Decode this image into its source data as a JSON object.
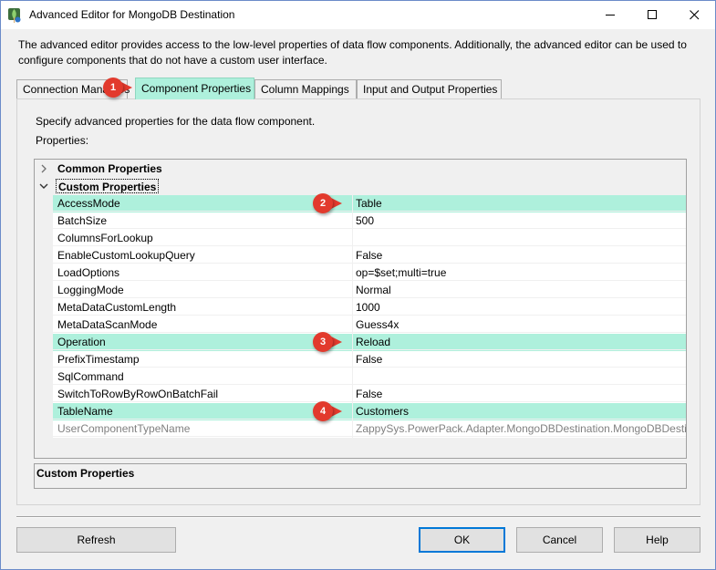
{
  "window": {
    "title": "Advanced Editor for MongoDB Destination"
  },
  "description": "The advanced editor provides access to the low-level properties of data flow components. Additionally, the advanced editor can be used to configure components that do not have a custom user interface.",
  "tabs": [
    {
      "label": "Connection Managers"
    },
    {
      "label": "Component Properties"
    },
    {
      "label": "Column Mappings"
    },
    {
      "label": "Input and Output Properties"
    }
  ],
  "panel": {
    "description": "Specify advanced properties for the data flow component.",
    "properties_label": "Properties:"
  },
  "grid": {
    "categories": {
      "common": "Common Properties",
      "custom": "Custom Properties"
    },
    "rows": [
      {
        "name": "AccessMode",
        "value": "Table"
      },
      {
        "name": "BatchSize",
        "value": "500"
      },
      {
        "name": "ColumnsForLookup",
        "value": ""
      },
      {
        "name": "EnableCustomLookupQuery",
        "value": "False"
      },
      {
        "name": "LoadOptions",
        "value": "op=$set;multi=true"
      },
      {
        "name": "LoggingMode",
        "value": "Normal"
      },
      {
        "name": "MetaDataCustomLength",
        "value": "1000"
      },
      {
        "name": "MetaDataScanMode",
        "value": "Guess4x"
      },
      {
        "name": "Operation",
        "value": "Reload"
      },
      {
        "name": "PrefixTimestamp",
        "value": "False"
      },
      {
        "name": "SqlCommand",
        "value": ""
      },
      {
        "name": "SwitchToRowByRowOnBatchFail",
        "value": "False"
      },
      {
        "name": "TableName",
        "value": "Customers"
      },
      {
        "name": "UserComponentTypeName",
        "value": "ZappySys.PowerPack.Adapter.MongoDBDestination.MongoDBDestination"
      }
    ]
  },
  "help_box": {
    "title": "Custom Properties"
  },
  "buttons": {
    "refresh": "Refresh",
    "ok": "OK",
    "cancel": "Cancel",
    "help": "Help"
  },
  "badges": [
    "1",
    "2",
    "3",
    "4"
  ],
  "colors": {
    "highlight": "#aef0dc",
    "badge": "#e23a2d",
    "default_button_border": "#0078d7"
  }
}
